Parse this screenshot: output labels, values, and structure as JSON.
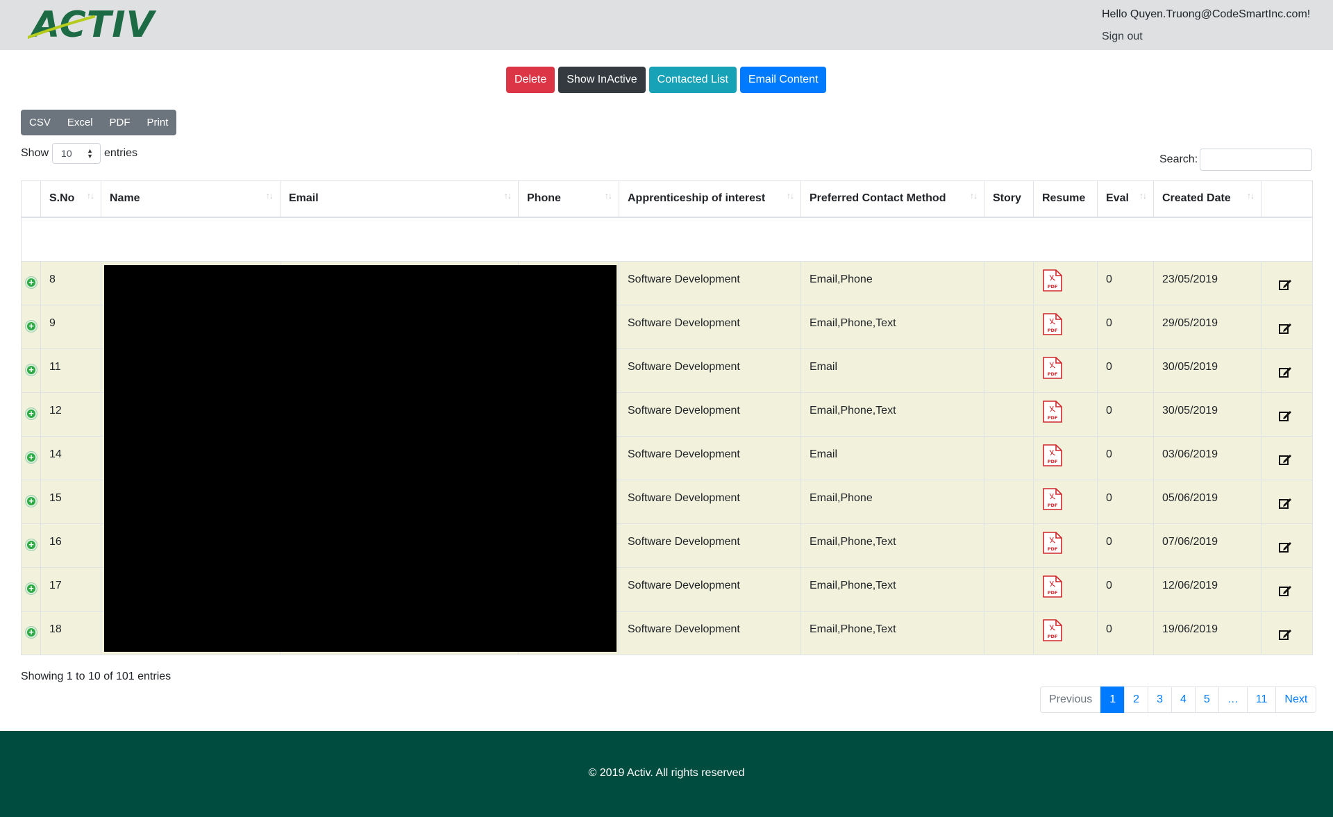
{
  "header": {
    "logo_text": "ACTIV",
    "greeting": "Hello Quyen.Truong@CodeSmartInc.com!",
    "signout": "Sign out"
  },
  "actions": {
    "delete": "Delete",
    "show_inactive": "Show InActive",
    "contacted_list": "Contacted List",
    "email_content": "Email Content"
  },
  "export": [
    "CSV",
    "Excel",
    "PDF",
    "Print"
  ],
  "length": {
    "show": "Show",
    "value": "10",
    "entries": "entries"
  },
  "search": {
    "label": "Search:"
  },
  "table": {
    "columns": [
      "",
      "S.No",
      "Name",
      "Email",
      "Phone",
      "Apprenticeship of interest",
      "Preferred Contact Method",
      "Story",
      "Resume",
      "Eval",
      "Created Date",
      ""
    ],
    "rows": [
      {
        "sno": "8",
        "apprenticeship": "Software Development",
        "contact": "Email,Phone",
        "eval": "0",
        "date": "23/05/2019"
      },
      {
        "sno": "9",
        "apprenticeship": "Software Development",
        "contact": "Email,Phone,Text",
        "eval": "0",
        "date": "29/05/2019"
      },
      {
        "sno": "11",
        "apprenticeship": "Software Development",
        "contact": "Email",
        "eval": "0",
        "date": "30/05/2019"
      },
      {
        "sno": "12",
        "apprenticeship": "Software Development",
        "contact": "Email,Phone,Text",
        "eval": "0",
        "date": "30/05/2019"
      },
      {
        "sno": "14",
        "apprenticeship": "Software Development",
        "contact": "Email",
        "eval": "0",
        "date": "03/06/2019"
      },
      {
        "sno": "15",
        "apprenticeship": "Software Development",
        "contact": "Email,Phone",
        "eval": "0",
        "date": "05/06/2019"
      },
      {
        "sno": "16",
        "apprenticeship": "Software Development",
        "contact": "Email,Phone,Text",
        "eval": "0",
        "date": "07/06/2019"
      },
      {
        "sno": "17",
        "apprenticeship": "Software Development",
        "contact": "Email,Phone,Text",
        "eval": "0",
        "date": "12/06/2019"
      },
      {
        "sno": "18",
        "apprenticeship": "Software Development",
        "contact": "Email,Phone,Text",
        "eval": "0",
        "date": "19/06/2019"
      }
    ]
  },
  "icons": {
    "expand": "plus-circle-icon",
    "resume": "pdf-file-icon",
    "edit": "edit-icon",
    "sort": "sort-arrows-icon"
  },
  "info": "Showing 1 to 10 of 101 entries",
  "pagination": [
    "Previous",
    "1",
    "2",
    "3",
    "4",
    "5",
    "…",
    "11",
    "Next"
  ],
  "footer": "© 2019 Activ. All rights reserved",
  "colors": {
    "header_bg": "#dee0e2",
    "row_bg": "#f2f2dc",
    "footer_bg": "#004d40",
    "danger": "#dc3545",
    "dark": "#343a40",
    "info": "#17a2b8",
    "primary": "#007bff",
    "secondary": "#6c757d"
  }
}
